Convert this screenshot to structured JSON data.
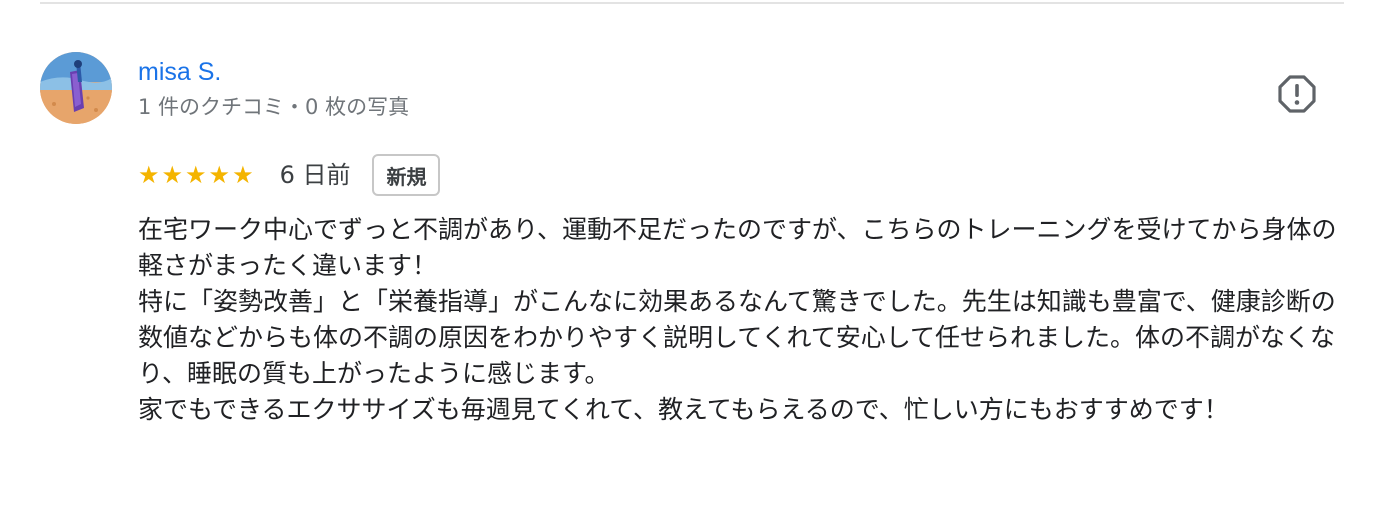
{
  "review": {
    "reviewer_name": "misa S.",
    "reviewer_stats": "1 件のクチコミ・0 枚の写真",
    "rating": 5,
    "stars": [
      "★",
      "★",
      "★",
      "★",
      "★"
    ],
    "date": "6 日前",
    "badge": "新規",
    "body": [
      "在宅ワーク中心でずっと不調があり、運動不足だったのですが、こちらのトレーニングを受けてから身体の軽さがまったく違います！",
      "特に「姿勢改善」と「栄養指導」がこんなに効果あるなんて驚きでした。先生は知識も豊富で、健康診断の数値などからも体の不調の原因をわかりやすく説明してくれて安心して任せられました。体の不調がなくなり、睡眠の質も上がったように感じます。",
      "家でもできるエクササイズも毎週見てくれて、教えてもらえるので、忙しい方にもおすすめです！"
    ]
  },
  "colors": {
    "name_link": "#1a73e8",
    "meta_text": "#70757a",
    "body_text": "#202124",
    "star": "#f4b400",
    "badge_border": "#c7c7c7",
    "divider": "#e3e3e3"
  },
  "icons": {
    "avatar": "reviewer-avatar-image",
    "report": "report-octagon-exclamation-icon",
    "star": "star-icon"
  }
}
